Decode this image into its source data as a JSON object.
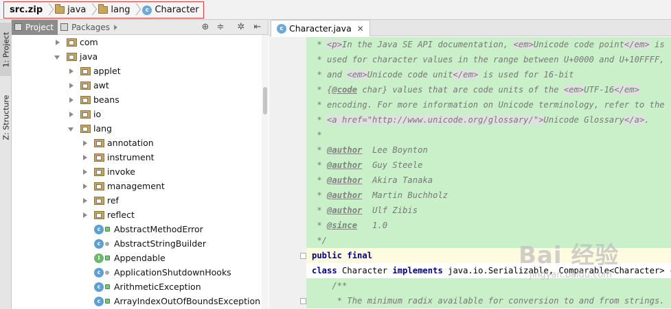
{
  "breadcrumb": {
    "items": [
      {
        "label": "src.zip",
        "icon": "zip-icon"
      },
      {
        "label": "java",
        "icon": "folder-icon"
      },
      {
        "label": "lang",
        "icon": "folder-icon"
      },
      {
        "label": "Character",
        "icon": "class-icon"
      }
    ]
  },
  "toolwindow": {
    "project_tab": "1: Project",
    "structure_tab": "Z: Structure"
  },
  "project_panel": {
    "tabs": [
      {
        "label": "Project",
        "active": true
      },
      {
        "label": "Packages",
        "active": false
      }
    ],
    "tree": [
      {
        "label": "com",
        "indent": 1,
        "arrow": "r",
        "kind": "pkg"
      },
      {
        "label": "java",
        "indent": 1,
        "arrow": "d",
        "kind": "pkg"
      },
      {
        "label": "applet",
        "indent": 2,
        "arrow": "r",
        "kind": "pkg"
      },
      {
        "label": "awt",
        "indent": 2,
        "arrow": "r",
        "kind": "pkg"
      },
      {
        "label": "beans",
        "indent": 2,
        "arrow": "r",
        "kind": "pkg"
      },
      {
        "label": "io",
        "indent": 2,
        "arrow": "r",
        "kind": "pkg"
      },
      {
        "label": "lang",
        "indent": 2,
        "arrow": "d",
        "kind": "pkg"
      },
      {
        "label": "annotation",
        "indent": 3,
        "arrow": "r",
        "kind": "pkg"
      },
      {
        "label": "instrument",
        "indent": 3,
        "arrow": "r",
        "kind": "pkg"
      },
      {
        "label": "invoke",
        "indent": 3,
        "arrow": "r",
        "kind": "pkg"
      },
      {
        "label": "management",
        "indent": 3,
        "arrow": "r",
        "kind": "pkg"
      },
      {
        "label": "ref",
        "indent": 3,
        "arrow": "r",
        "kind": "pkg"
      },
      {
        "label": "reflect",
        "indent": 3,
        "arrow": "r",
        "kind": "pkg"
      },
      {
        "label": "AbstractMethodError",
        "indent": 3,
        "arrow": "n",
        "kind": "class-lock"
      },
      {
        "label": "AbstractStringBuilder",
        "indent": 3,
        "arrow": "n",
        "kind": "class-dot"
      },
      {
        "label": "Appendable",
        "indent": 3,
        "arrow": "n",
        "kind": "interface-lock"
      },
      {
        "label": "ApplicationShutdownHooks",
        "indent": 3,
        "arrow": "n",
        "kind": "class-dot"
      },
      {
        "label": "ArithmeticException",
        "indent": 3,
        "arrow": "n",
        "kind": "class-lock"
      },
      {
        "label": "ArrayIndexOutOfBoundsException",
        "indent": 3,
        "arrow": "n",
        "kind": "class-lock"
      }
    ]
  },
  "editor": {
    "tab_label": "Character.java",
    "lines": [
      {
        "type": "doc",
        "html": " * <span class=\"html\">&lt;p&gt;</span>In the Java SE API documentation, <span class=\"html\">&lt;em&gt;</span>Unicode code point<span class=\"html\">&lt;/em&gt;</span> is"
      },
      {
        "type": "doc",
        "html": " * used for character values in the range between U+0000 and U+10FFFF,"
      },
      {
        "type": "doc",
        "html": " * and <span class=\"html\">&lt;em&gt;</span>Unicode code unit<span class=\"html\">&lt;/em&gt;</span> is used for 16-bit"
      },
      {
        "type": "doc",
        "html": " * {<span class=\"tag\">@code</span> char} values that are code units of the <span class=\"html\">&lt;em&gt;</span>UTF-16<span class=\"html\">&lt;/em&gt;</span>"
      },
      {
        "type": "doc",
        "html": " * encoding. For more information on Unicode terminology, refer to the"
      },
      {
        "type": "doc",
        "html": " * <span class=\"html\">&lt;a href=\"http://www.unicode.org/glossary/\"&gt;</span>Unicode Glossary<span class=\"html\">&lt;/a&gt;</span>."
      },
      {
        "type": "doc",
        "html": " *"
      },
      {
        "type": "doc",
        "html": " * <span class=\"tag\">@author</span>  Lee Boynton"
      },
      {
        "type": "doc",
        "html": " * <span class=\"tag\">@author</span>  Guy Steele"
      },
      {
        "type": "doc",
        "html": " * <span class=\"tag\">@author</span>  Akira Tanaka"
      },
      {
        "type": "doc",
        "html": " * <span class=\"tag\">@author</span>  Martin Buchholz"
      },
      {
        "type": "doc",
        "html": " * <span class=\"tag\">@author</span>  Ulf Zibis"
      },
      {
        "type": "doc",
        "html": " * <span class=\"tag\">@since</span>   1.0"
      },
      {
        "type": "doc",
        "html": " */"
      },
      {
        "type": "caret",
        "html": "<span class=\"kw\">public final</span>"
      },
      {
        "type": "code",
        "html": "<span class=\"kw\">class</span> Character <span class=\"kw\">implements</span> java.io.Serializable, Comparable&lt;Character&gt; {"
      },
      {
        "type": "doc",
        "html": "    /**"
      },
      {
        "type": "doc",
        "html": "     * The minimum radix available for conversion to and from strings."
      }
    ]
  },
  "watermark": {
    "text": "Bai  经验",
    "url": "jingyan.baidu.com"
  }
}
